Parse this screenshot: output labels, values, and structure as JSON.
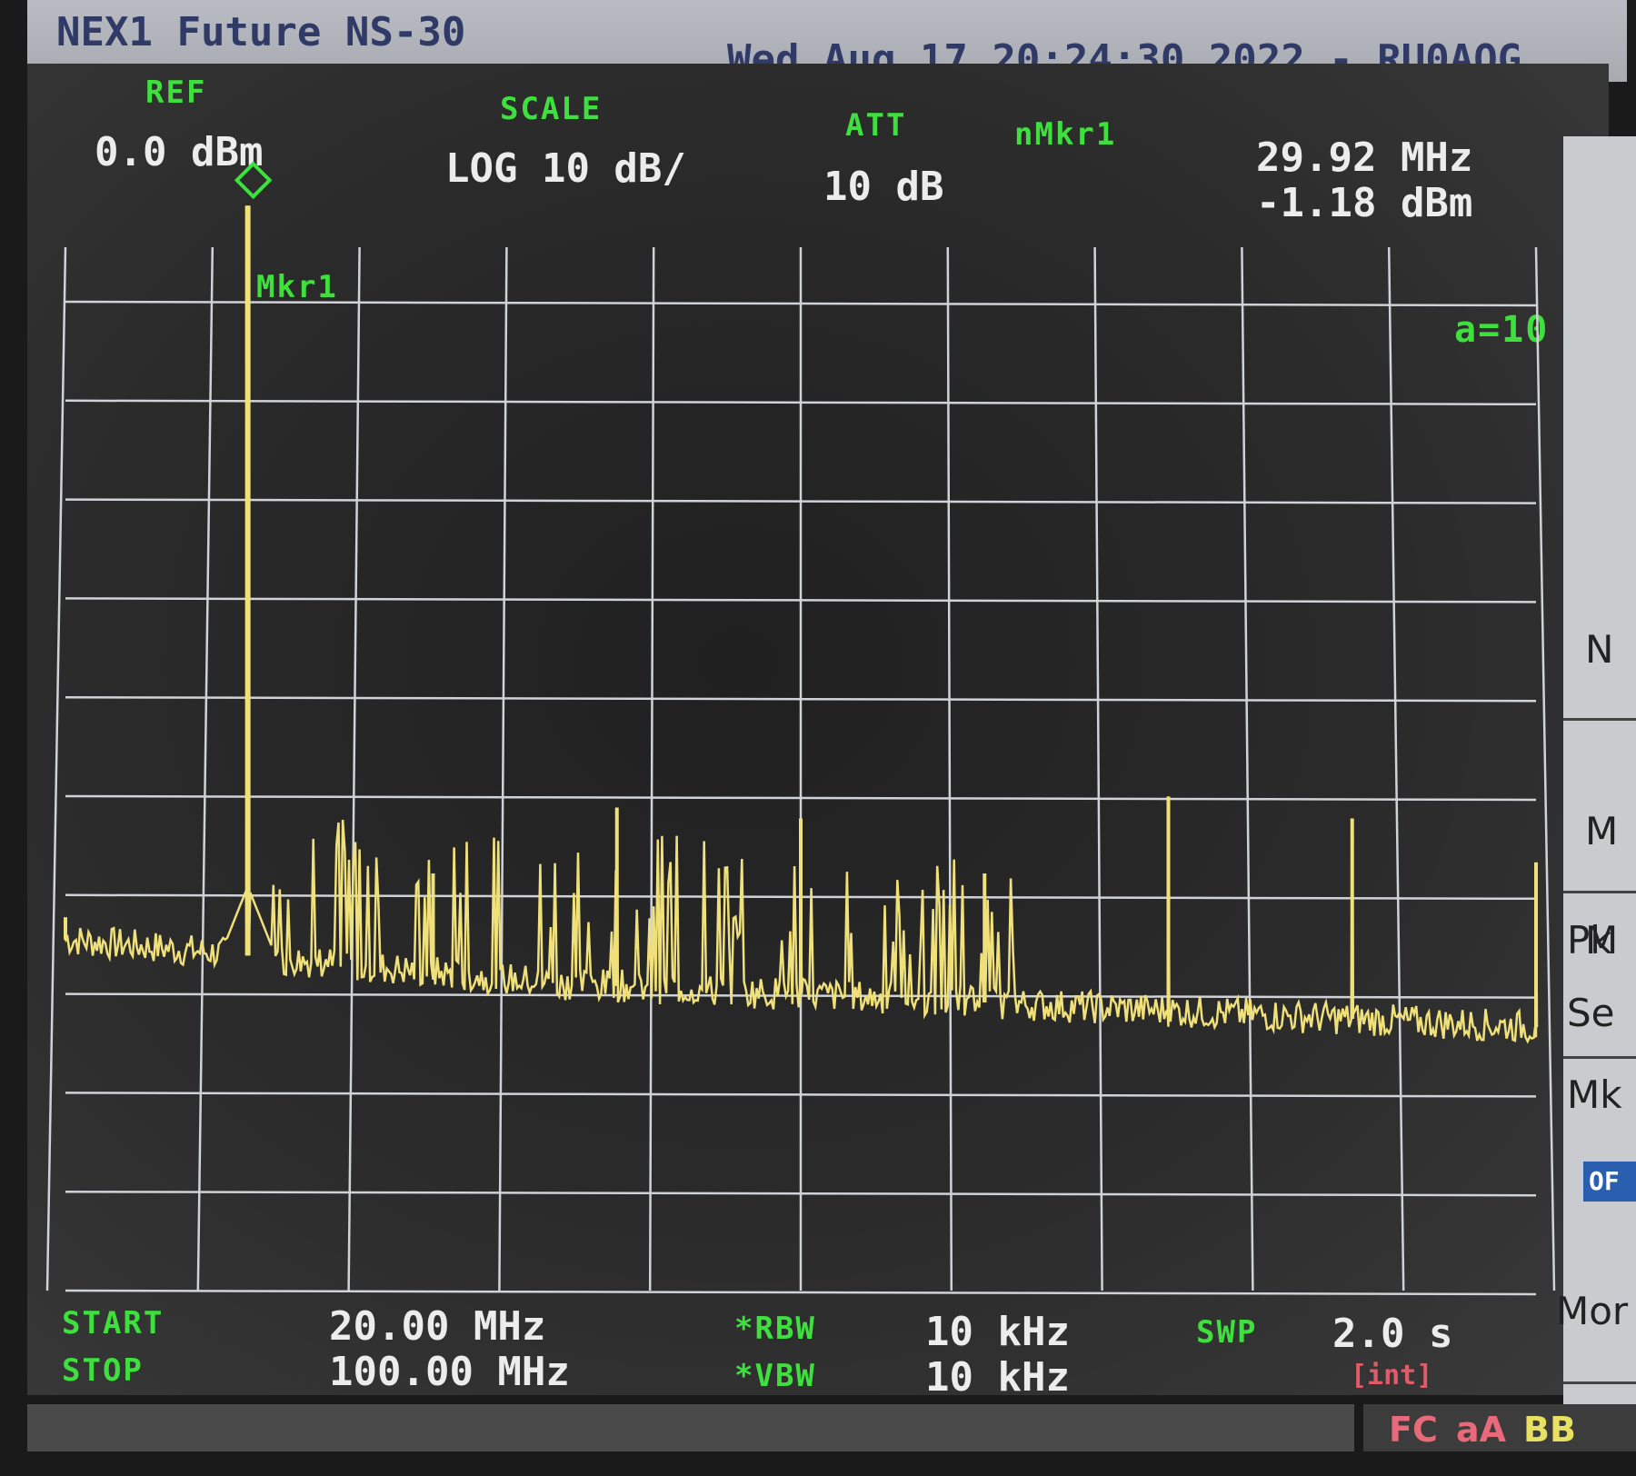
{
  "window": {
    "app_title": "NEX1 Future NS-30",
    "datetime": "Wed Aug 17 20:24:30 2022 - RU0AOG"
  },
  "header": {
    "ref_label": "REF",
    "ref_value": "0.0 dBm",
    "scale_label": "SCALE",
    "scale_value": "LOG 10 dB/",
    "att_label": "ATT",
    "att_value": "10 dB",
    "marker_label": "nMkr1",
    "marker_freq": "29.92 MHz",
    "marker_level": "-1.18 dBm"
  },
  "trace": {
    "marker_tag": "Mkr1",
    "avg_label": "a=10",
    "color": "#f0e07a"
  },
  "footer": {
    "start_label": "START",
    "start_value": "20.00 MHz",
    "stop_label": "STOP",
    "stop_value": "100.00 MHz",
    "rbw_label": "*RBW",
    "rbw_value": "10 kHz",
    "vbw_label": "*VBW",
    "vbw_value": "10 kHz",
    "swp_label": "SWP",
    "swp_value": "2.0 s",
    "swp_mode": "[int]"
  },
  "side_softkeys": [
    "M",
    "N",
    "M",
    "Pk",
    "Se",
    "Mk",
    "Mor"
  ],
  "side_off": "OF",
  "status_flags": [
    "FC",
    "aA",
    "BB"
  ],
  "chart_data": {
    "type": "line",
    "title": "",
    "xlabel": "",
    "ylabel": "",
    "x_range_mhz": [
      20,
      100
    ],
    "y_range_dbm": [
      -100,
      0
    ],
    "reference_level_dbm": 0,
    "scale_db_per_div": 10,
    "grid": true,
    "series": [
      {
        "x": [
          20,
          29.92,
          40,
          50,
          60,
          70,
          80,
          90,
          100
        ],
        "y": [
          -66,
          -1.18,
          -62,
          -56,
          -57,
          -62,
          -55,
          -57,
          -61
        ],
        "noise_floor_dbm": [
          -68,
          -72,
          -74,
          -76
        ]
      }
    ]
  }
}
